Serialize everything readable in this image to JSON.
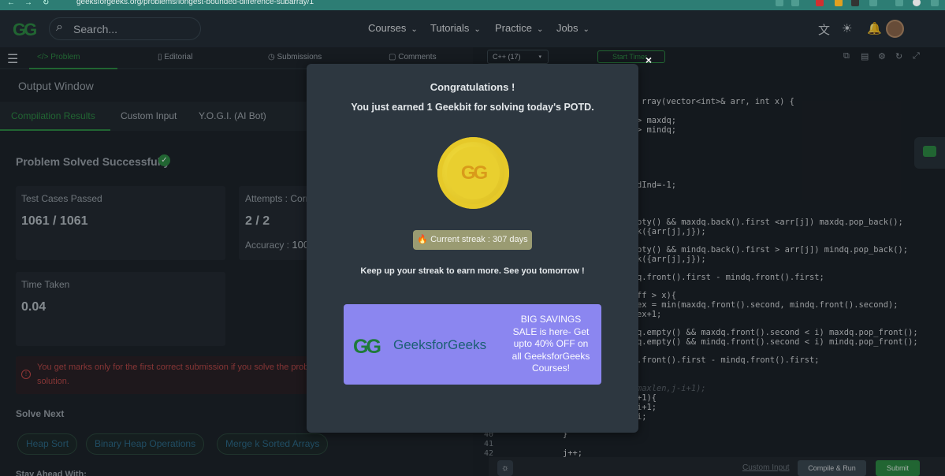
{
  "browser": {
    "url": "geeksforgeeks.org/problems/longest-bounded-difference-subarray/1"
  },
  "header": {
    "logo": "GG",
    "search_placeholder": "Search...",
    "menus": [
      "Courses",
      "Tutorials",
      "Practice",
      "Jobs"
    ]
  },
  "problem_tabs": [
    "Problem",
    "Editorial",
    "Submissions",
    "Comments"
  ],
  "editor": {
    "language": "C++ (17)",
    "start_timer": "Start Timer"
  },
  "left": {
    "title": "Output Window",
    "subtabs": [
      "Compilation Results",
      "Custom Input",
      "Y.O.G.I. (AI Bot)"
    ],
    "status": "Problem Solved Successfully",
    "cards": {
      "testcases_label": "Test Cases Passed",
      "testcases_value": "1061 / 1061",
      "attempts_label": "Attempts : Corr",
      "attempts_value": "2 / 2",
      "accuracy_label": "Accuracy :",
      "accuracy_value": "100",
      "time_label": "Time Taken",
      "time_value": "0.04"
    },
    "note_line1": "You get marks only for the first correct submission if you solve the prob",
    "note_line2": "solution.",
    "solve_next": "Solve Next",
    "chips": [
      "Heap Sort",
      "Binary Heap Operations",
      "Merge k Sorted Arrays"
    ],
    "stay_ahead": "Stay Ahead With:"
  },
  "code_lines": [
    "rray(vector<int>& arr, int x) {",
    "> maxdq;",
    "> mindq;",
    "dInd=-1;",
    "pty() && maxdq.back().first <arr[j]) maxdq.pop_back();",
    "k({arr[j],j});",
    "pty() && mindq.back().first > arr[j]) mindq.pop_back();",
    "k({arr[j],j});",
    "q.front().first - mindq.front().first;",
    "ff > x){",
    "ex = min(maxdq.front().second, mindq.front().second);",
    "ex+1;",
    "q.empty() && maxdq.front().second < i) maxdq.pop_front();",
    "q.empty() && mindq.front().second < i) mindq.pop_front();",
    ".front().first - mindq.front().first;",
    "maxlen,j-i+1);",
    "+1){",
    "i+1;",
    "i;",
    "}",
    "j++;"
  ],
  "line_numbers": [
    "40",
    "41",
    "42"
  ],
  "bottom": {
    "custom_input": "Custom Input",
    "compile": "Compile & Run",
    "submit": "Submit"
  },
  "modal": {
    "title": "Congratulations !",
    "earned": "You just earned 1 Geekbit for solving today's POTD.",
    "coin_logo": "GG",
    "streak": "🔥 Current streak : 307 days",
    "keep_up": "Keep up your streak to earn more. See you tomorrow !",
    "banner_brand": "GeeksforGeeks",
    "banner_logo": "GG",
    "banner_text": "BIG SAVINGS SALE is here- Get upto 40% OFF on all GeeksforGeeks Courses!",
    "close": "×"
  },
  "colors": {
    "brand_green": "#2f8d46",
    "banner_purple": "#8b86f0",
    "coin_gold": "#e9cf2f"
  }
}
